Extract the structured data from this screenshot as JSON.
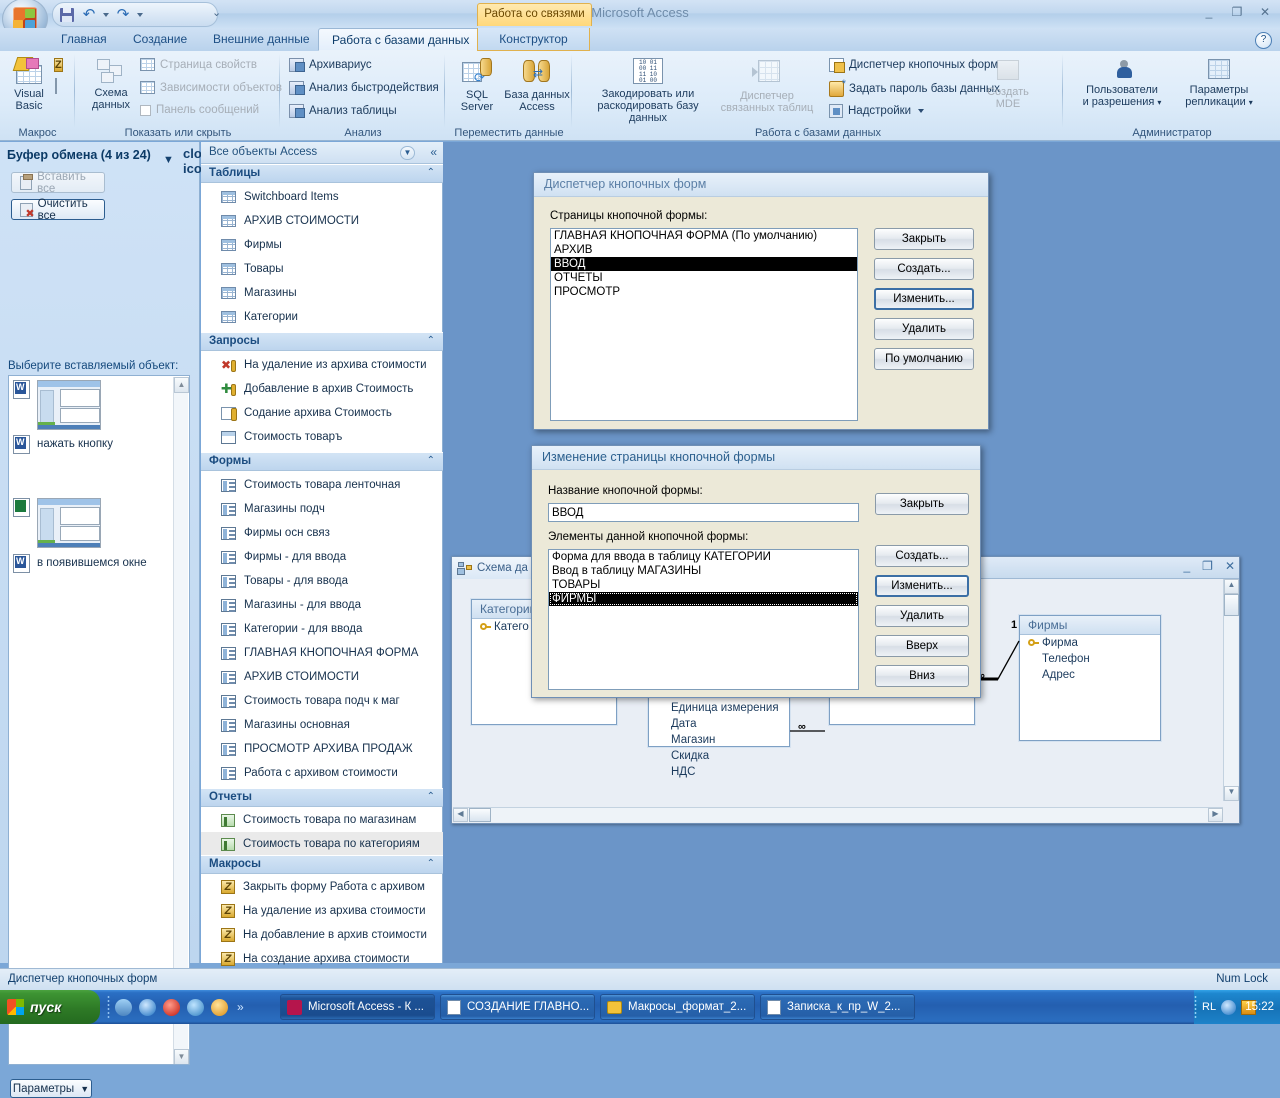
{
  "window": {
    "app_title": "Microsoft Access",
    "contextual_tab_group": "Работа со связями",
    "minimize": "_",
    "restore": "❐",
    "close": "✕",
    "help": "?"
  },
  "quick_access": {
    "items": [
      "save-icon",
      "undo-icon",
      "redo-icon",
      "relationships-icon",
      "datasheet-icon",
      "print-preview-icon",
      "customize-qat-icon"
    ]
  },
  "ribbon": {
    "tabs": [
      {
        "label": "Главная",
        "active": false
      },
      {
        "label": "Создание",
        "active": false
      },
      {
        "label": "Внешние данные",
        "active": false
      },
      {
        "label": "Работа с базами данных",
        "active": true
      },
      {
        "label": "Конструктор",
        "active": false,
        "contextual": true
      }
    ],
    "groups": [
      {
        "label": "Макрос",
        "big": [
          {
            "label": "Visual\nBasic",
            "icon": "visual-basic-icon"
          }
        ],
        "small": []
      },
      {
        "label": "Показать или скрыть",
        "big": [
          {
            "label": "Схема\nданных",
            "icon": "relationships-icon"
          }
        ],
        "small": [
          {
            "label": "Страница свойств",
            "icon": "property-sheet-icon",
            "disabled": true
          },
          {
            "label": "Зависимости объектов",
            "icon": "object-dependencies-icon",
            "disabled": true
          },
          {
            "label": "Панель сообщений",
            "icon": "message-bar-icon",
            "disabled": true
          }
        ]
      },
      {
        "label": "Анализ",
        "small": [
          {
            "label": "Архивариус",
            "icon": "database-documenter-icon",
            "disabled": false
          },
          {
            "label": "Анализ быстродействия",
            "icon": "performance-analyzer-icon",
            "disabled": false
          },
          {
            "label": "Анализ таблицы",
            "icon": "table-analyzer-icon",
            "disabled": false
          }
        ]
      },
      {
        "label": "Переместить данные",
        "big": [
          {
            "label": "SQL\nServer",
            "icon": "sql-server-icon"
          },
          {
            "label": "База данных\nAccess",
            "icon": "access-database-icon"
          }
        ]
      },
      {
        "label": "Работа с базами данных",
        "big": [
          {
            "label": "Закодировать или\nраскодировать базу данных",
            "icon": "encode-decode-icon"
          },
          {
            "label": "Диспетчер\nсвязанных таблиц",
            "icon": "linked-table-manager-icon",
            "disabled": true
          },
          {
            "label": "Создать\nMDE",
            "icon": "make-mde-icon",
            "disabled": true
          }
        ],
        "small": [
          {
            "label": "Диспетчер кнопочных форм",
            "icon": "switchboard-manager-icon"
          },
          {
            "label": "Задать пароль базы данных",
            "icon": "set-password-icon"
          },
          {
            "label": "Надстройки",
            "icon": "add-ins-icon",
            "dropdown": true
          }
        ]
      },
      {
        "label": "Администратор",
        "big": [
          {
            "label": "Пользователи\nи разрешения",
            "icon": "users-permissions-icon",
            "dropdown": true
          },
          {
            "label": "Параметры\nрепликации",
            "icon": "replication-options-icon",
            "dropdown": true
          }
        ]
      }
    ]
  },
  "clipboard_pane": {
    "title": "Буфер обмена (4 из 24)",
    "dropdown_icon": "chevron-down-icon",
    "close_icon": "close-icon",
    "paste_all_label": "Вставить все",
    "clear_all_label": "Очистить все",
    "prompt": "Выберите вставляемый объект:",
    "items": [
      {
        "type": "thumbnail",
        "icon": "word-doc-icon",
        "label": ""
      },
      {
        "type": "text",
        "icon": "word-doc-icon",
        "label": "нажать кнопку"
      },
      {
        "type": "thumbnail",
        "icon": "image-doc-icon",
        "label": ""
      },
      {
        "type": "text",
        "icon": "word-doc-icon",
        "label": "в появившемся окне"
      }
    ],
    "options_label": "Параметры"
  },
  "nav_pane": {
    "header": "Все объекты Access",
    "dropdown_icon": "chevron-down-icon",
    "collapse_icon": "double-chevron-left-icon",
    "groups": [
      {
        "label": "Таблицы",
        "icon_kind": "table",
        "items": [
          {
            "label": "Switchboard Items"
          },
          {
            "label": "АРХИВ СТОИМОСТИ"
          },
          {
            "label": "Фирмы"
          },
          {
            "label": "Товары"
          },
          {
            "label": "Магазины"
          },
          {
            "label": "Категории"
          }
        ]
      },
      {
        "label": "Запросы",
        "icon_kind": "query",
        "items": [
          {
            "label": "На удаление из архива стоимости",
            "icon": "delete-query-icon"
          },
          {
            "label": "Добавление в архив Стоимость",
            "icon": "append-query-icon"
          },
          {
            "label": "Содание архива Стоимость",
            "icon": "make-table-query-icon"
          },
          {
            "label": "Стоимость товаръ",
            "icon": "select-query-icon"
          }
        ]
      },
      {
        "label": "Формы",
        "icon_kind": "form",
        "items": [
          {
            "label": "Стоимость товара ленточная"
          },
          {
            "label": "Магазины подч"
          },
          {
            "label": "Фирмы осн связ"
          },
          {
            "label": "Фирмы - для ввода"
          },
          {
            "label": "Товары - для ввода"
          },
          {
            "label": "Магазины - для ввода"
          },
          {
            "label": "Категории - для ввода"
          },
          {
            "label": "ГЛАВНАЯ КНОПОЧНАЯ ФОРМА"
          },
          {
            "label": "АРХИВ СТОИМОСТИ"
          },
          {
            "label": "Стоимость товара подч к маг"
          },
          {
            "label": "Магазины основная"
          },
          {
            "label": "ПРОСМОТР АРХИВА ПРОДАЖ"
          },
          {
            "label": "Работа с архивом стоимости"
          }
        ]
      },
      {
        "label": "Отчеты",
        "icon_kind": "report",
        "items": [
          {
            "label": "Стоимость товара по магазинам",
            "selected": false
          },
          {
            "label": "Стоимость товара по категориям",
            "selected": true
          }
        ]
      },
      {
        "label": "Макросы",
        "icon_kind": "macro",
        "items": [
          {
            "label": "Закрыть форму Работа с архивом"
          },
          {
            "label": "На удаление из архива стоимости"
          },
          {
            "label": "На добавление в архив стоимости"
          },
          {
            "label": "На создание архива стоимости"
          }
        ]
      }
    ]
  },
  "relationships_window": {
    "tab_label": "Схема да",
    "tab_icon": "relationships-icon",
    "minimize": "_",
    "restore": "❐",
    "close": "✕",
    "tables": [
      {
        "name": "Категории",
        "fields": [
          {
            "label": "Катего",
            "key": true
          }
        ]
      },
      {
        "name": "",
        "fields": [
          {
            "label": "Единица измерения",
            "key": false
          },
          {
            "label": "Дата",
            "key": false
          },
          {
            "label": "Магазин",
            "key": false
          },
          {
            "label": "Скидка",
            "key": false
          },
          {
            "label": "НДС",
            "key": false
          }
        ]
      },
      {
        "name": "Фирмы",
        "fields": [
          {
            "label": "Фирма",
            "key": true
          },
          {
            "label": "Телефон",
            "key": false
          },
          {
            "label": "Адрес",
            "key": false
          }
        ]
      }
    ],
    "relation_labels": {
      "one": "1",
      "many": "∞"
    }
  },
  "switchboard_manager": {
    "title": "Диспетчер кнопочных форм",
    "list_label": "Страницы кнопочной формы:",
    "pages": [
      {
        "label": "ГЛАВНАЯ КНОПОЧНАЯ ФОРМА (По умолчанию)",
        "selected": false
      },
      {
        "label": "АРХИВ",
        "selected": false
      },
      {
        "label": "ВВОД",
        "selected": true
      },
      {
        "label": "ОТЧЕТЫ",
        "selected": false
      },
      {
        "label": "ПРОСМОТР",
        "selected": false
      }
    ],
    "buttons": [
      {
        "label": "Закрыть",
        "default": false
      },
      {
        "label": "Создать...",
        "default": false
      },
      {
        "label": "Изменить...",
        "default": true
      },
      {
        "label": "Удалить",
        "default": false
      },
      {
        "label": "По умолчанию",
        "default": false
      }
    ]
  },
  "edit_switchboard_page": {
    "title": "Изменение страницы кнопочной формы",
    "name_label": "Название кнопочной формы:",
    "name_value": "ВВОД",
    "items_label": "Элементы данной кнопочной формы:",
    "items": [
      {
        "label": "Форма для ввода в таблицу КАТЕГОРИИ",
        "selected": false
      },
      {
        "label": "Ввод в таблицу МАГАЗИНЫ",
        "selected": false
      },
      {
        "label": "ТОВАРЫ",
        "selected": false
      },
      {
        "label": "ФИРМЫ",
        "selected": true
      }
    ],
    "buttons": [
      {
        "label": "Закрыть",
        "default": false
      },
      {
        "label": "Создать...",
        "default": false
      },
      {
        "label": "Изменить...",
        "default": true
      },
      {
        "label": "Удалить",
        "default": false
      },
      {
        "label": "Вверх",
        "default": false
      },
      {
        "label": "Вниз",
        "default": false
      }
    ]
  },
  "status_bar": {
    "left": "Диспетчер кнопочных форм",
    "right": "Num Lock"
  },
  "taskbar": {
    "start_label": "пуск",
    "quick_launch": [
      "show-desktop-icon",
      "internet-explorer-icon",
      "opera-icon",
      "firefox-icon",
      "media-player-icon"
    ],
    "quick_launch_more": "»",
    "buttons": [
      {
        "label": "Microsoft Access - К ...",
        "icon": "access-icon",
        "active": true
      },
      {
        "label": "СОЗДАНИЕ ГЛАВНО...",
        "icon": "word-icon",
        "active": false
      },
      {
        "label": "Макросы_формат_2...",
        "icon": "folder-icon",
        "active": false
      },
      {
        "label": "Записка_к_пр_W_2...",
        "icon": "word-icon",
        "active": false
      }
    ],
    "tray": {
      "language": "RL",
      "icons": [
        "volume-icon",
        "antivirus-icon"
      ],
      "clock": "15:22"
    }
  },
  "colors": {
    "accent": "#2d618f",
    "ribbon_bg": "#dcebf9",
    "selection": "#000000",
    "taskbar": "#245fb0",
    "contextual_tab": "#ffd87a"
  }
}
